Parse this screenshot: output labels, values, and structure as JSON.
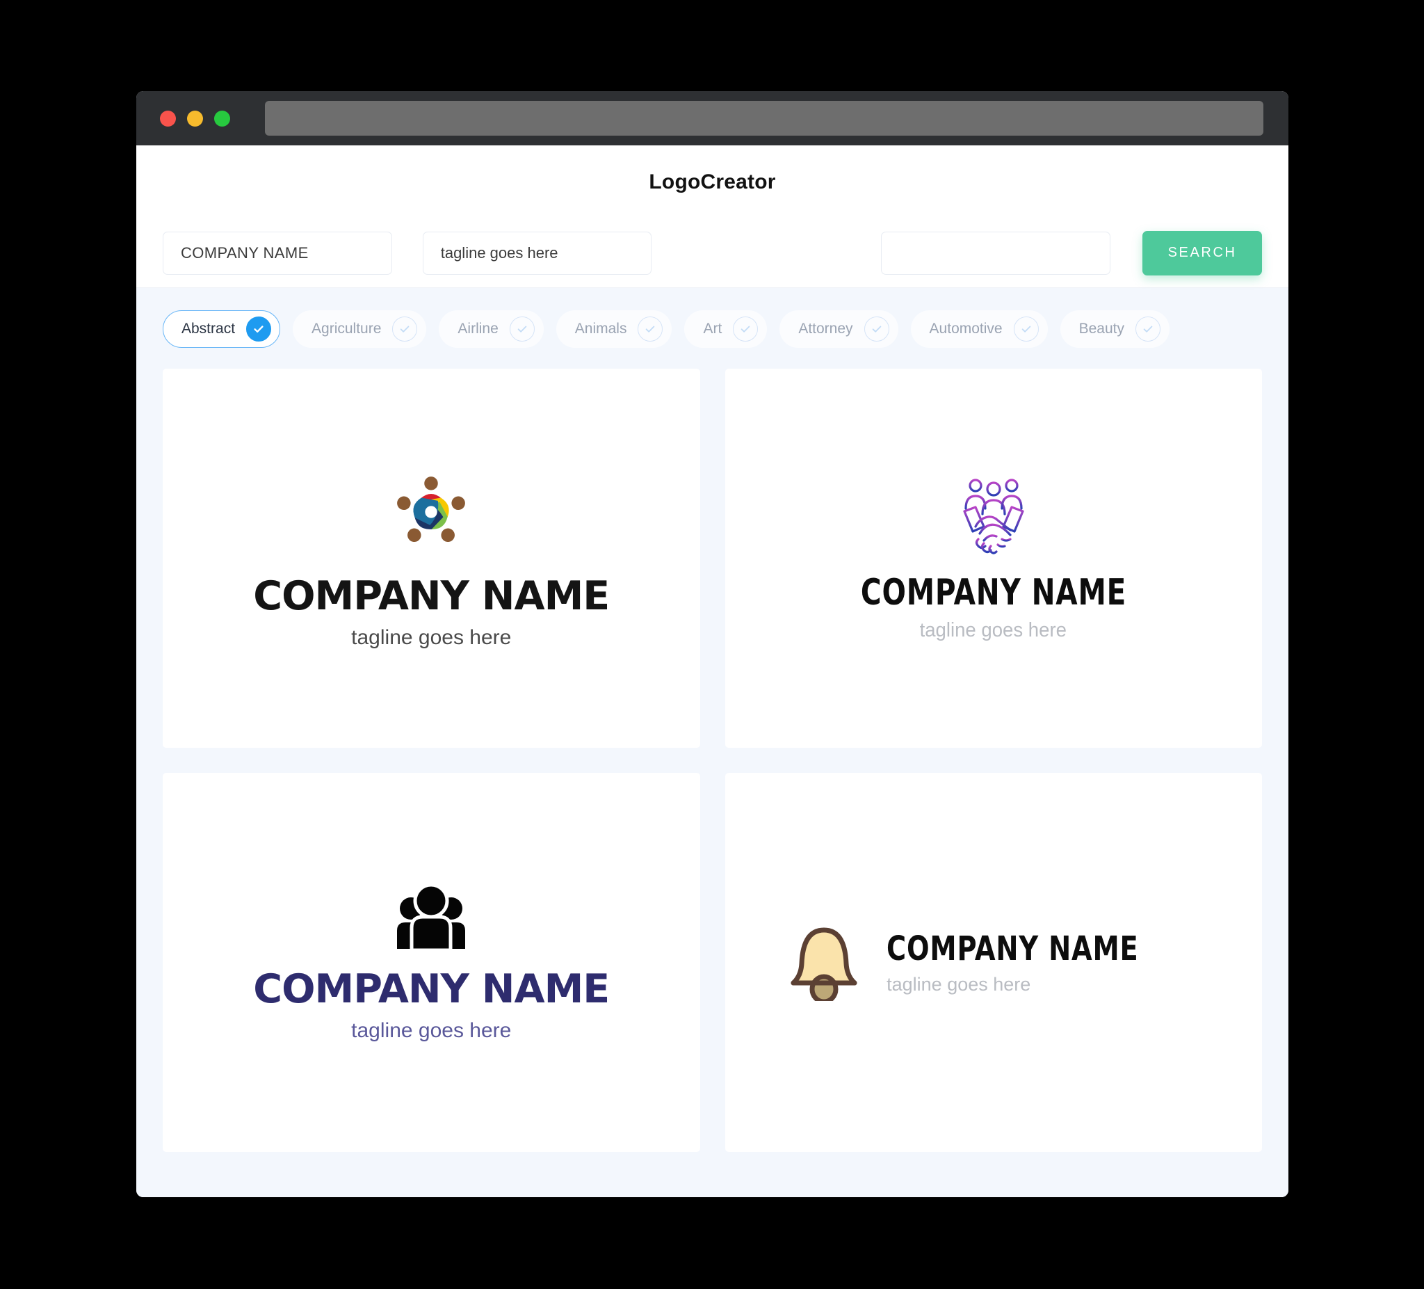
{
  "window": {
    "traffic_lights": [
      "close",
      "minimize",
      "maximize"
    ],
    "url_value": ""
  },
  "header": {
    "app_title": "LogoCreator"
  },
  "search": {
    "company_name_value": "COMPANY NAME",
    "tagline_value": "tagline goes here",
    "third_field_value": "",
    "search_button_label": "SEARCH"
  },
  "categories": {
    "items": [
      {
        "label": "Abstract",
        "selected": true
      },
      {
        "label": "Agriculture",
        "selected": false
      },
      {
        "label": "Airline",
        "selected": false
      },
      {
        "label": "Animals",
        "selected": false
      },
      {
        "label": "Art",
        "selected": false
      },
      {
        "label": "Attorney",
        "selected": false
      },
      {
        "label": "Automotive",
        "selected": false
      },
      {
        "label": "Beauty",
        "selected": false
      }
    ],
    "next_icon": "arrow-right-icon"
  },
  "results": [
    {
      "icon": "teamwork-circle-icon",
      "company_name": "COMPANY NAME",
      "tagline": "tagline goes here",
      "name_color": "#141414",
      "tagline_color": "#4a4a4a",
      "layout": "stacked"
    },
    {
      "icon": "handshake-people-icon",
      "company_name": "COMPANY NAME",
      "tagline": "tagline goes here",
      "name_color": "#0d0d0d",
      "tagline_color": "#b9bcc2",
      "layout": "stacked"
    },
    {
      "icon": "group-people-solid-icon",
      "company_name": "COMPANY NAME",
      "tagline": "tagline goes here",
      "name_color": "#2e2c6e",
      "tagline_color": "#5a589a",
      "layout": "stacked"
    },
    {
      "icon": "bell-icon",
      "company_name": "COMPANY NAME",
      "tagline": "tagline goes here",
      "name_color": "#0d0d0d",
      "tagline_color": "#b9bcc2",
      "layout": "horizontal"
    }
  ],
  "colors": {
    "accent_green": "#4ec99b",
    "accent_blue": "#1e9bf0",
    "page_background": "#f3f7fd",
    "titlebar": "#2e3033"
  }
}
